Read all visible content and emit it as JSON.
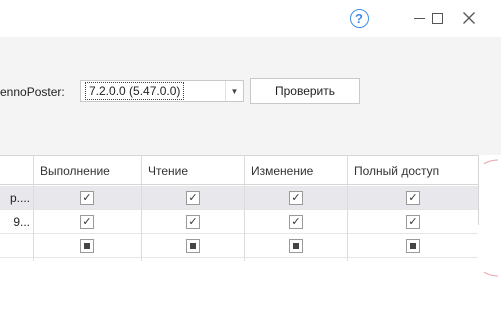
{
  "window": {
    "help_symbol": "?",
    "close_symbol": "✕"
  },
  "version_row": {
    "label": "ennoPoster:",
    "selected_value": "7.2.0.0 (5.47.0.0)",
    "dropdown_arrow": "▼",
    "check_button_label": "Проверить"
  },
  "table": {
    "columns": [
      "Выполнение",
      "Чтение",
      "Изменение",
      "Полный доступ"
    ],
    "rows": [
      {
        "name": "р....",
        "selected": true,
        "states": [
          "checked",
          "checked",
          "checked",
          "checked"
        ]
      },
      {
        "name": "9...",
        "selected": false,
        "states": [
          "checked",
          "checked",
          "checked",
          "checked"
        ]
      },
      {
        "name": "",
        "selected": false,
        "states": [
          "indeterminate",
          "indeterminate",
          "indeterminate",
          "indeterminate"
        ]
      }
    ],
    "check_glyph": "✓"
  },
  "colors": {
    "accent": "#3f8be8",
    "panel_bg": "#f4f4f4",
    "selected_row": "#e8e8ec",
    "decoration": "#e8a0a8"
  }
}
